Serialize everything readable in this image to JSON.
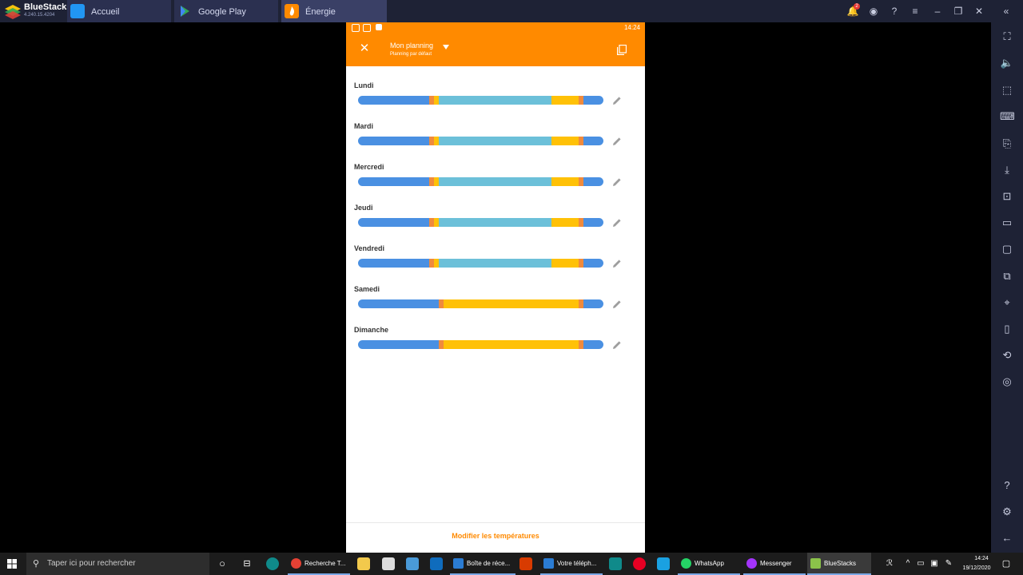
{
  "bluestacks": {
    "name": "BlueStacks",
    "version": "4.240.15.4204",
    "notification_count": "2",
    "tabs": [
      {
        "label": "Accueil",
        "icon": "home-icon"
      },
      {
        "label": "Google Play",
        "icon": "play-store-icon"
      },
      {
        "label": "Énergie",
        "icon": "flame-icon"
      }
    ]
  },
  "android_status": {
    "time": "14:24"
  },
  "appbar": {
    "title": "Mon planning",
    "subtitle": "Planning par défaut",
    "close_icon": "close-icon",
    "copy_icon": "copy-icon"
  },
  "colors": {
    "orange": "#ff8a00",
    "blue": "#4a90e2",
    "light_blue": "#6cc0d9",
    "yellow": "#ffc107",
    "orange_segment": "#f08a3c"
  },
  "days": [
    {
      "label": "Lundi",
      "segments": [
        [
          "blue",
          0.29
        ],
        [
          "orange_segment",
          0.02
        ],
        [
          "yellow",
          0.02
        ],
        [
          "light_blue",
          0.46
        ],
        [
          "yellow",
          0.11
        ],
        [
          "orange_segment",
          0.02
        ],
        [
          "blue",
          0.08
        ]
      ]
    },
    {
      "label": "Mardi",
      "segments": [
        [
          "blue",
          0.29
        ],
        [
          "orange_segment",
          0.02
        ],
        [
          "yellow",
          0.02
        ],
        [
          "light_blue",
          0.46
        ],
        [
          "yellow",
          0.11
        ],
        [
          "orange_segment",
          0.02
        ],
        [
          "blue",
          0.08
        ]
      ]
    },
    {
      "label": "Mercredi",
      "segments": [
        [
          "blue",
          0.29
        ],
        [
          "orange_segment",
          0.02
        ],
        [
          "yellow",
          0.02
        ],
        [
          "light_blue",
          0.46
        ],
        [
          "yellow",
          0.11
        ],
        [
          "orange_segment",
          0.02
        ],
        [
          "blue",
          0.08
        ]
      ]
    },
    {
      "label": "Jeudi",
      "segments": [
        [
          "blue",
          0.29
        ],
        [
          "orange_segment",
          0.02
        ],
        [
          "yellow",
          0.02
        ],
        [
          "light_blue",
          0.46
        ],
        [
          "yellow",
          0.11
        ],
        [
          "orange_segment",
          0.02
        ],
        [
          "blue",
          0.08
        ]
      ]
    },
    {
      "label": "Vendredi",
      "segments": [
        [
          "blue",
          0.29
        ],
        [
          "orange_segment",
          0.02
        ],
        [
          "yellow",
          0.02
        ],
        [
          "light_blue",
          0.46
        ],
        [
          "yellow",
          0.11
        ],
        [
          "orange_segment",
          0.02
        ],
        [
          "blue",
          0.08
        ]
      ]
    },
    {
      "label": "Samedi",
      "segments": [
        [
          "blue",
          0.33
        ],
        [
          "orange_segment",
          0.02
        ],
        [
          "yellow",
          0.55
        ],
        [
          "orange_segment",
          0.02
        ],
        [
          "blue",
          0.08
        ]
      ]
    },
    {
      "label": "Dimanche",
      "segments": [
        [
          "blue",
          0.33
        ],
        [
          "orange_segment",
          0.02
        ],
        [
          "yellow",
          0.55
        ],
        [
          "orange_segment",
          0.02
        ],
        [
          "blue",
          0.08
        ]
      ]
    }
  ],
  "footer": {
    "modify_label": "Modifier les températures"
  },
  "taskbar": {
    "search_placeholder": "Taper ici pour rechercher",
    "apps": [
      {
        "label": "Recherche T...",
        "color": "#e44134"
      },
      {
        "label": "Boîte de réce...",
        "color": "#2b7cd3"
      },
      {
        "label": "Votre téléph...",
        "color": "#2b7cd3"
      },
      {
        "label": "WhatsApp",
        "color": "#25d366"
      },
      {
        "label": "Messenger",
        "color": "#a334fa"
      },
      {
        "label": "BlueStacks",
        "color": "#8bc34a"
      }
    ],
    "time": "14:24",
    "date": "19/12/2020"
  }
}
